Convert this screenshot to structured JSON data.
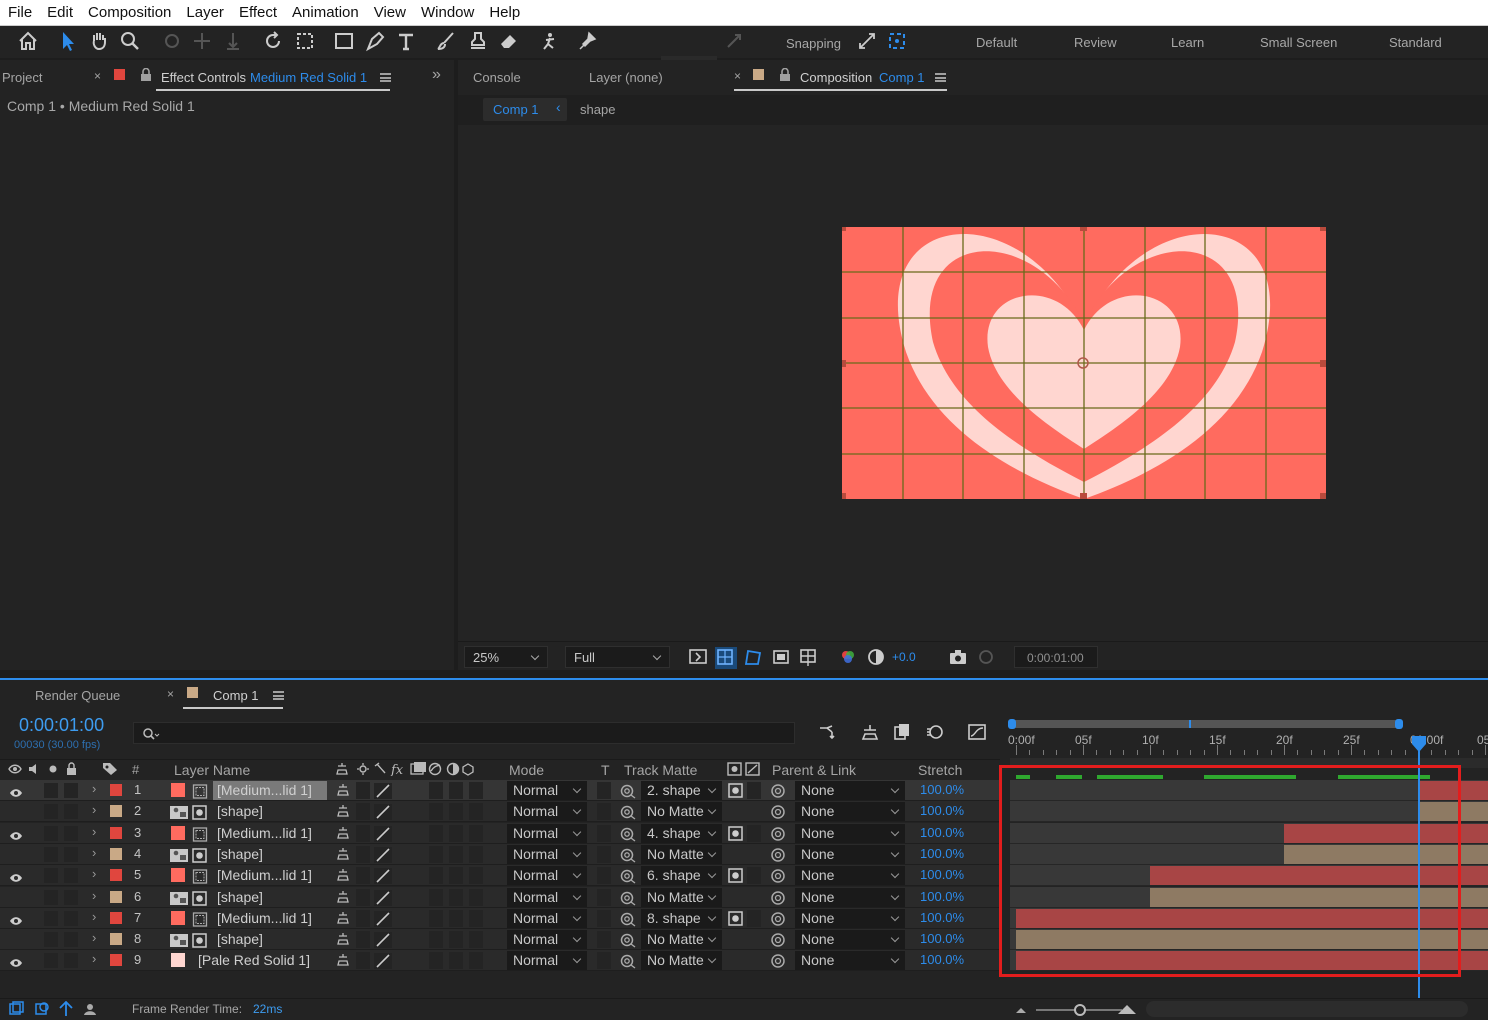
{
  "menu": [
    "File",
    "Edit",
    "Composition",
    "Layer",
    "Effect",
    "Animation",
    "View",
    "Window",
    "Help"
  ],
  "toolbar": {
    "snapping_label": "Snapping",
    "workspaces": [
      "Default",
      "Review",
      "Learn",
      "Small Screen",
      "Standard"
    ]
  },
  "left_panel": {
    "project_tab": "Project",
    "effect_controls_tab": "Effect Controls",
    "effect_controls_layer": "Medium Red Solid 1",
    "breadcrumb": "Comp 1 • Medium Red Solid 1"
  },
  "comp_panel": {
    "console_tab": "Console",
    "layer_tab": "Layer (none)",
    "composition_tab": "Composition",
    "composition_name": "Comp 1",
    "crumb_comp": "Comp 1",
    "crumb_shape": "shape",
    "zoom": "25%",
    "resolution": "Full",
    "exposure": "+0.0",
    "timecode": "0:00:01:00",
    "colors": {
      "bg": "#ff6b5f",
      "heart_light": "#ffd6d0",
      "grid": "#6a6a1a"
    }
  },
  "timeline": {
    "render_queue_tab": "Render Queue",
    "comp_tab": "Comp 1",
    "current_time": "0:00:01:00",
    "frame_info": "00030 (30.00 fps)",
    "ruler_labels": [
      "0:00f",
      "05f",
      "10f",
      "15f",
      "20f",
      "25f",
      "01:00f",
      "05"
    ],
    "columns": {
      "number": "#",
      "layer_name": "Layer Name",
      "mode": "Mode",
      "t": "T",
      "track_matte": "Track Matte",
      "parent_link": "Parent & Link",
      "stretch": "Stretch"
    },
    "frame_render_label": "Frame Render Time:",
    "frame_render_value": "22ms",
    "layers": [
      {
        "num": "1",
        "label_color": "#e0463e",
        "name": "[Medium...lid 1]",
        "mode": "Normal",
        "matte": "2. shape",
        "parent": "None",
        "stretch": "100.0%",
        "visible": true,
        "bar_color": "#a84545",
        "bar_start": 30
      },
      {
        "num": "2",
        "label_color": "#c9a986",
        "name": "[shape]",
        "mode": "Normal",
        "matte": "No Matte",
        "parent": "None",
        "stretch": "100.0%",
        "visible": false,
        "bar_color": "#8e7a63",
        "bar_start": 30
      },
      {
        "num": "3",
        "label_color": "#e0463e",
        "name": "[Medium...lid 1]",
        "mode": "Normal",
        "matte": "4. shape",
        "parent": "None",
        "stretch": "100.0%",
        "visible": true,
        "bar_color": "#a84545",
        "bar_start": 20
      },
      {
        "num": "4",
        "label_color": "#c9a986",
        "name": "[shape]",
        "mode": "Normal",
        "matte": "No Matte",
        "parent": "None",
        "stretch": "100.0%",
        "visible": false,
        "bar_color": "#8e7a63",
        "bar_start": 20
      },
      {
        "num": "5",
        "label_color": "#e0463e",
        "name": "[Medium...lid 1]",
        "mode": "Normal",
        "matte": "6. shape",
        "parent": "None",
        "stretch": "100.0%",
        "visible": true,
        "bar_color": "#a84545",
        "bar_start": 10
      },
      {
        "num": "6",
        "label_color": "#c9a986",
        "name": "[shape]",
        "mode": "Normal",
        "matte": "No Matte",
        "parent": "None",
        "stretch": "100.0%",
        "visible": false,
        "bar_color": "#8e7a63",
        "bar_start": 10
      },
      {
        "num": "7",
        "label_color": "#e0463e",
        "name": "[Medium...lid 1]",
        "mode": "Normal",
        "matte": "8. shape",
        "parent": "None",
        "stretch": "100.0%",
        "visible": true,
        "bar_color": "#a84545",
        "bar_start": 0
      },
      {
        "num": "8",
        "label_color": "#c9a986",
        "name": "[shape]",
        "mode": "Normal",
        "matte": "No Matte",
        "parent": "None",
        "stretch": "100.0%",
        "visible": false,
        "bar_color": "#8e7a63",
        "bar_start": 0
      },
      {
        "num": "9",
        "label_color": "#e0463e",
        "name": "[Pale Red Solid 1]",
        "mode": "Normal",
        "matte": "No Matte",
        "parent": "None",
        "stretch": "100.0%",
        "visible": true,
        "bar_color": "#a84545",
        "bar_start": 0
      }
    ]
  }
}
